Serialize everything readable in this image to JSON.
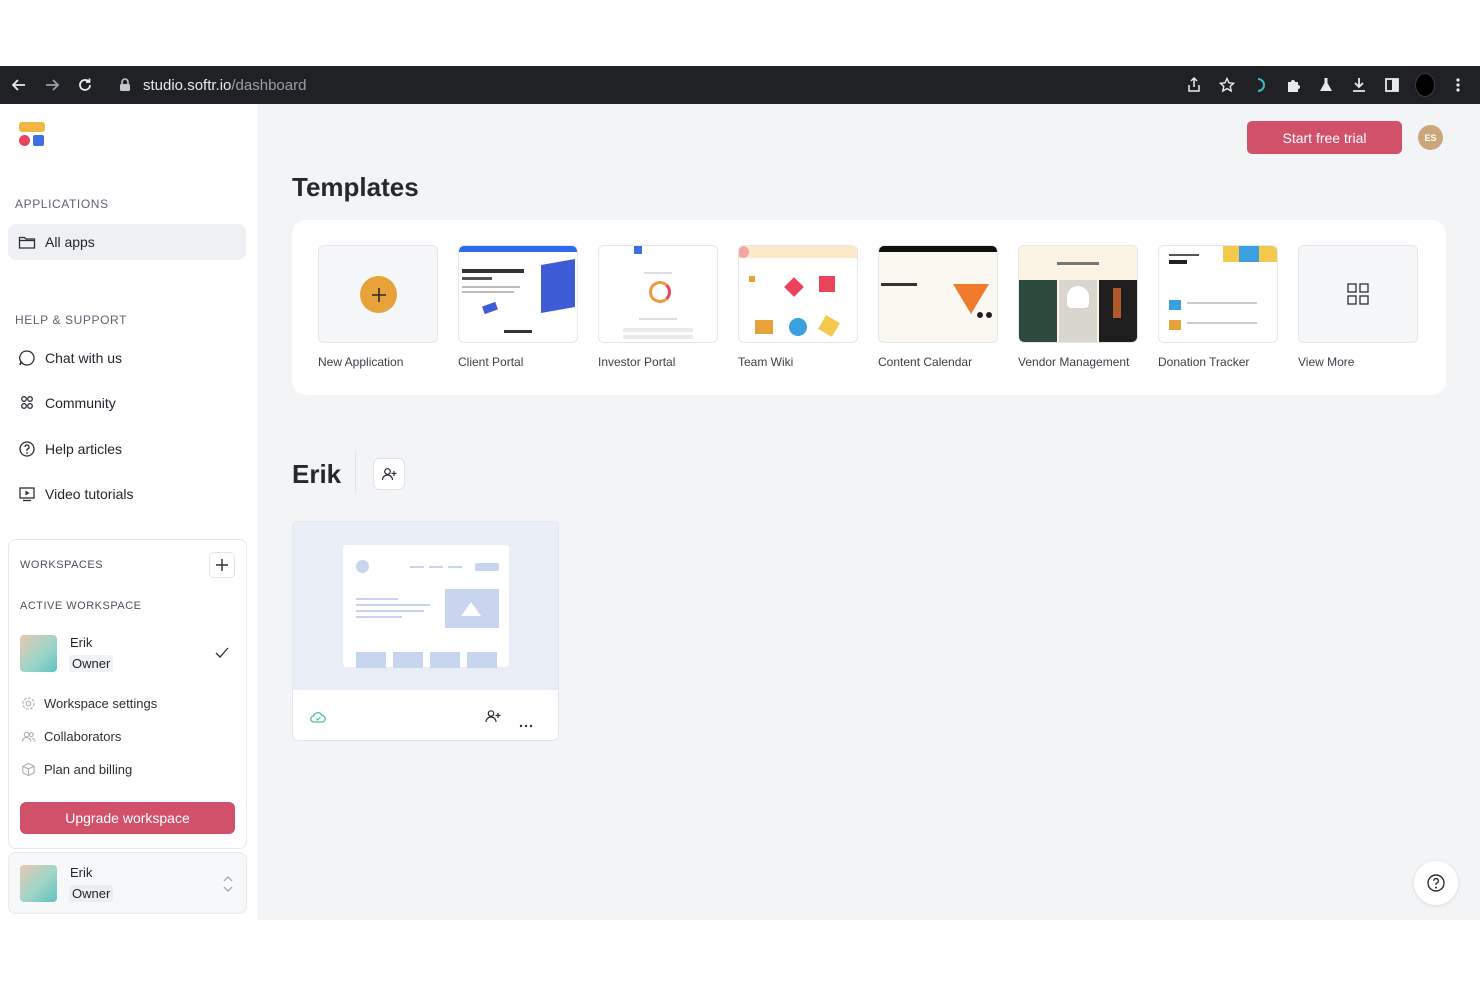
{
  "browser": {
    "url_host": "studio.softr.io",
    "url_path": "/dashboard"
  },
  "sidebar": {
    "applications_title": "APPLICATIONS",
    "all_apps": "All apps",
    "help_title": "HELP & SUPPORT",
    "help_items": [
      {
        "label": "Chat with us",
        "icon": "chat-icon"
      },
      {
        "label": "Community",
        "icon": "community-icon"
      },
      {
        "label": "Help articles",
        "icon": "question-icon"
      },
      {
        "label": "Video tutorials",
        "icon": "video-icon"
      }
    ],
    "workspaces_title": "WORKSPACES",
    "active_workspace_title": "ACTIVE WORKSPACE",
    "active_workspace": {
      "name": "Erik",
      "role": "Owner"
    },
    "workspace_links": [
      {
        "label": "Workspace settings",
        "icon": "gear-icon"
      },
      {
        "label": "Collaborators",
        "icon": "users-icon"
      },
      {
        "label": "Plan and billing",
        "icon": "box-icon"
      }
    ],
    "upgrade_label": "Upgrade workspace",
    "switcher": {
      "name": "Erik",
      "role": "Owner"
    }
  },
  "header": {
    "trial_label": "Start free trial",
    "avatar_initials": "ES"
  },
  "templates": {
    "title": "Templates",
    "items": [
      {
        "label": "New Application"
      },
      {
        "label": "Client Portal"
      },
      {
        "label": "Investor Portal"
      },
      {
        "label": "Team Wiki"
      },
      {
        "label": "Content Calendar"
      },
      {
        "label": "Vendor Management"
      },
      {
        "label": "Donation Tracker"
      },
      {
        "label": "View More"
      }
    ]
  },
  "workspace_section": {
    "title": "Erik"
  },
  "colors": {
    "accent": "#d1506a",
    "avatar": "#c9a77b",
    "plus_circle": "#e8a23a"
  }
}
